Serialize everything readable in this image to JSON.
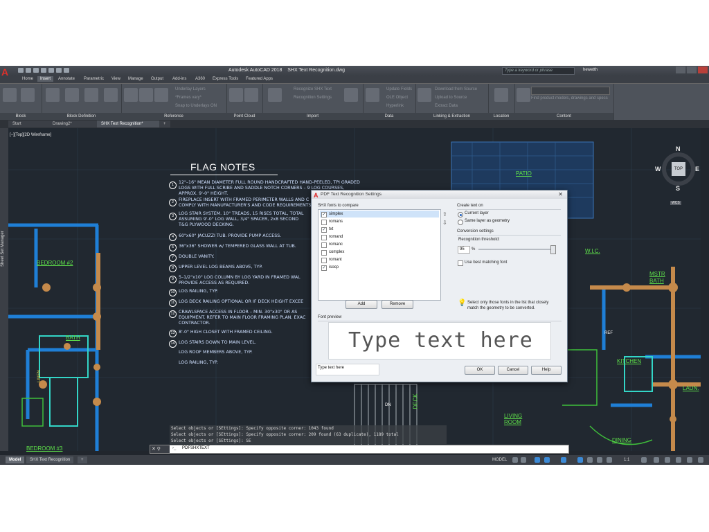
{
  "window": {
    "title": "Autodesk AutoCAD 2018    SHX Text Recognition.dwg",
    "search_placeholder": "Type a keyword or phrase",
    "user": "hewetth"
  },
  "ribbon_tabs": [
    "Home",
    "Insert",
    "Annotate",
    "Parametric",
    "View",
    "Manage",
    "Output",
    "Add-ins",
    "A360",
    "Express Tools",
    "Featured Apps"
  ],
  "ribbon_active_tab": "Insert",
  "ribbon_panels": {
    "block": "Block",
    "block_definition": "Block Definition",
    "reference": "Reference",
    "point_cloud": "Point Cloud",
    "import": "Import",
    "data": "Data",
    "linking": "Linking & Extraction",
    "location": "Location",
    "content": "Content"
  },
  "ribbon_items": {
    "underlay_layers": "Underlay Layers",
    "frames_vary": "*Frames vary*",
    "snap_to_underlays": "Snap to Underlays ON",
    "recognize_shx": "Recognize SHX Text",
    "recognition_settings": "Recognition Settings",
    "update_fields": "Update Fields",
    "ole_object": "OLE Object",
    "hyperlink": "Hyperlink",
    "download_from_source": "Download from Source",
    "upload_to_source": "Upload to Source",
    "extract_data": "Extract  Data",
    "find_product_models": "Find product models, drawings and specs"
  },
  "doc_tabs": [
    "Start",
    "Drawing2*",
    "SHX Text Recognition*"
  ],
  "doc_active": "SHX Text Recognition*",
  "viewport_label": "[−][Top][2D Wireframe]",
  "sheet_set": "Sheet Set Manager",
  "flag_notes": {
    "title": "FLAG NOTES",
    "items": [
      {
        "num": "1",
        "lines": "12\"–16\" MEAN DIAMETER FULL ROUND HANDCRAFTED HAND-PEELED, TPI GRADED\nLOGS WITH FULL SCRIBE AND SADDLE NOTCH CORNERS – 9 LOG COURSES,\nAPPROX. 9'-0\" HEIGHT."
      },
      {
        "num": "2",
        "lines": "FIREPLACE INSERT WITH FRAMED PERIMETER WALLS AND C\nCOMPLY WITH MANUFACTURER'S AND CODE REQUIREMENTS"
      },
      {
        "num": "3",
        "lines": "LOG STAIR SYSTEM. 10\" TREADS, 15 RISES TOTAL, TOTAL\nASSUMING 9'-0\" LOG WALL, 3/4\" SPACER, 2x8 SECOND\nT&G PLYWOOD DECKING."
      },
      {
        "num": "4",
        "lines": "60\"x60\" JACUZZI TUB. PROVIDE PUMP ACCESS."
      },
      {
        "num": "5",
        "lines": "36\"x36\" SHOWER w/ TEMPERED GLASS WALL AT TUB."
      },
      {
        "num": "7",
        "lines": "DOUBLE VANITY."
      },
      {
        "num": "8",
        "lines": "UPPER LEVEL LOG BEAMS ABOVE, TYP."
      },
      {
        "num": "9",
        "lines": "5–1/2\"x10\" LOG COLUMN BY LOG YARD IN FRAMED WAL\nPROVIDE ACCESS AS REQUIRED."
      },
      {
        "num": "10",
        "lines": "LOG RAILING, TYP."
      },
      {
        "num": "11",
        "lines": "LOG DECK RAILING OPTIONAL OR IF DECK HEIGHT EXCEE"
      },
      {
        "num": "12",
        "lines": "CRAWLSPACE ACCESS IN FLOOR – MIN. 30\"x30\" OR AS\nEQUIPMENT. REFER TO MAIN FLOOR FRAMING PLAN. EXAC\nCONTRACTOR."
      },
      {
        "num": "13",
        "lines": "8'-0\" HIGH CLOSET WITH FRAMED CEILING."
      },
      {
        "num": "14",
        "lines": "LOG STAIRS DOWN TO MAIN LEVEL."
      },
      {
        "num": "",
        "lines": "LOG ROOF MEMBERS ABOVE, TYP."
      },
      {
        "num": "",
        "lines": "LOG RAILING, TYP."
      }
    ]
  },
  "rooms": {
    "bedroom2": "BEDROOM #2",
    "bath": "BATH",
    "bedroom3": "BEDROOM #3",
    "patio": "PATIO",
    "wic": "W.I.C.",
    "mstr_bath_1": "MSTR",
    "mstr_bath_2": "BATH",
    "kitchen": "KITCHEN",
    "laun": "LAUN.",
    "living_room_1": "LIVING",
    "living_room_2": "ROOM",
    "dining": "DINING",
    "deck": "DECK",
    "ref": "REF",
    "dn": "DN",
    "linen": "LINEN"
  },
  "compass": {
    "n": "N",
    "s": "S",
    "e": "E",
    "w": "W",
    "top": "TOP",
    "wcs": "WCS"
  },
  "dialog": {
    "title": "PDF Text Recognition Settings",
    "fonts_label": "SHX fonts to compare",
    "fonts": [
      {
        "name": "simplex",
        "checked": true
      },
      {
        "name": "romans",
        "checked": false
      },
      {
        "name": "txt",
        "checked": true
      },
      {
        "name": "romand",
        "checked": false
      },
      {
        "name": "romanc",
        "checked": false
      },
      {
        "name": "complex",
        "checked": false
      },
      {
        "name": "romant",
        "checked": false
      },
      {
        "name": "isocp",
        "checked": true
      }
    ],
    "add": "Add",
    "remove": "Remove",
    "create_text_on": "Create text on",
    "current_layer": "Current layer",
    "same_layer": "Same layer as geometry",
    "conversion_settings": "Conversion settings",
    "recognition_threshold": "Recognition threshold:",
    "threshold_value": "95",
    "threshold_unit": "%",
    "best_match": "Use best matching font",
    "hint": "Select only those fonts in the list that closely match the geometry to be converted.",
    "font_preview": "Font preview",
    "preview_text": "Type text here",
    "preview_input": "Type text here",
    "ok": "OK",
    "cancel": "Cancel",
    "help": "Help"
  },
  "command_history": [
    "Select objects or [SEttings]: Specify opposite corner: 1043 found",
    "Select objects or [SEttings]: Specify opposite corner: 209 found (63 duplicate), 1189 total",
    "Select objects or [SEttings]: SE"
  ],
  "command_line": "PDFSHXTEXT",
  "layout_tabs": [
    "Model",
    "SHX Text Recognition"
  ],
  "status": {
    "model": "MODEL",
    "scale": "1:1"
  },
  "colors": {
    "accent": "#e0302a",
    "room_text": "#5ee04a",
    "walls": "#1f7fd6",
    "logs": "#c58a4b",
    "drawing_bg": "#212830"
  }
}
